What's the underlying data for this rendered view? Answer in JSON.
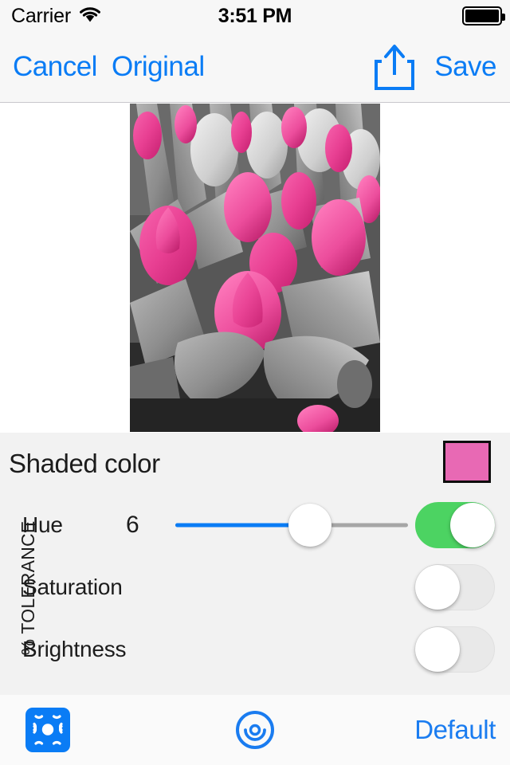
{
  "status_bar": {
    "carrier": "Carrier",
    "wifi_icon": "wifi-icon",
    "time": "3:51 PM",
    "battery_icon": "battery-full-icon"
  },
  "nav_bar": {
    "cancel_label": "Cancel",
    "original_label": "Original",
    "share_icon": "share-icon",
    "save_label": "Save"
  },
  "photo": {
    "description": "Selective color photo of pink tulips with grayscale foliage",
    "accent_color": "#E8459B",
    "gray_color": "#8a8a8a"
  },
  "panel": {
    "title": "Shaded color",
    "swatch_color": "#E869B4",
    "swatch_border": "#0D0D0D",
    "group_label": "% TOLERANCE",
    "rows": [
      {
        "label": "Hue",
        "value": "6",
        "slider_percent": 58,
        "toggle_on": true,
        "toggle_state": "on"
      },
      {
        "label": "Saturation",
        "value": "",
        "slider_percent": 0,
        "toggle_on": false,
        "toggle_state": "off"
      },
      {
        "label": "Brightness",
        "value": "",
        "slider_percent": 0,
        "toggle_on": false,
        "toggle_state": "off"
      }
    ]
  },
  "toolbar": {
    "chroma_icon": "chroma-key-icon",
    "picker_icon": "color-picker-target-icon",
    "default_label": "Default"
  },
  "colors": {
    "tint": "#0A7CF5",
    "toggle_on": "#4CD362",
    "panel_bg": "#F2F2F2",
    "bar_bg": "#F7F7F7"
  }
}
